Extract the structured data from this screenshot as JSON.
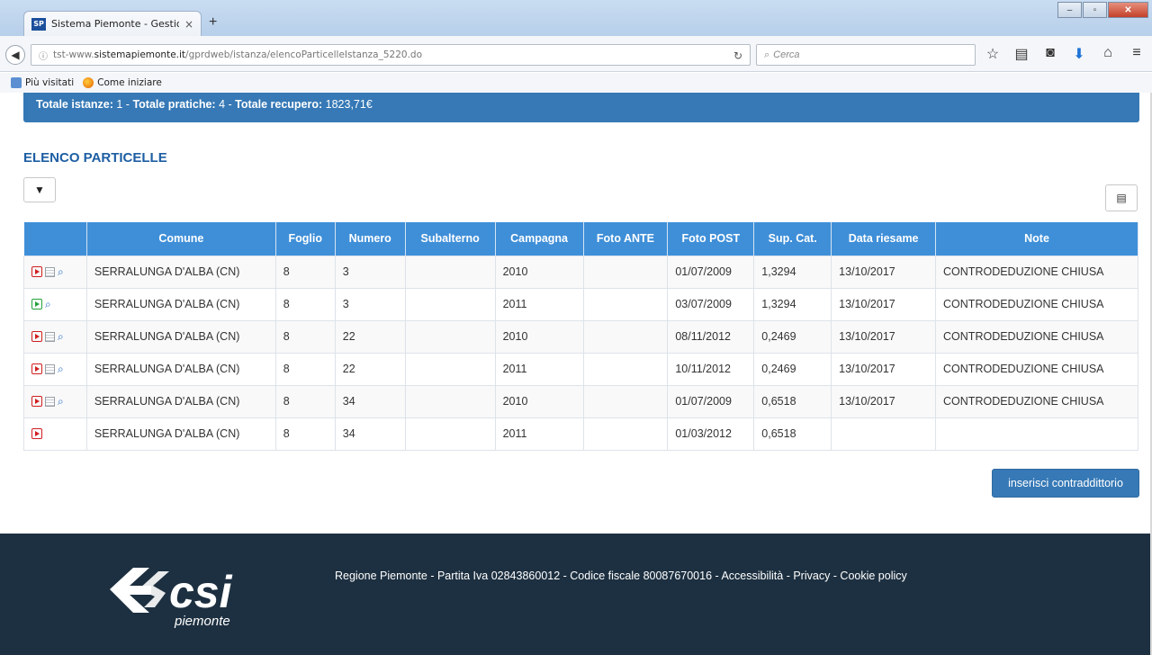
{
  "browser": {
    "tab_title": "Sistema Piemonte - Gestio...",
    "tab_favicon": "SP",
    "tab_close": "×",
    "new_tab": "+",
    "url_prefix": "tst-www.",
    "url_host": "sistemapiemonte.it",
    "url_path": "/gprdweb/istanza/elencoParticelleIstanza_5220.do",
    "search_placeholder": "Cerca",
    "bookmarks": [
      "Più visitati",
      "Come iniziare"
    ]
  },
  "banner": {
    "istanze_label": "Totale istanze:",
    "istanze_value": " 1 - ",
    "pratiche_label": "Totale pratiche:",
    "pratiche_value": " 4 - ",
    "recupero_label": "Totale recupero:",
    "recupero_value": " 1823,71€"
  },
  "section_title": "ELENCO PARTICELLE",
  "table": {
    "headers": [
      "",
      "Comune",
      "Foglio",
      "Numero",
      "Subalterno",
      "Campagna",
      "Foto ANTE",
      "Foto POST",
      "Sup. Cat.",
      "Data riesame",
      "Note"
    ],
    "rows": [
      {
        "icons": [
          "play-red",
          "doc",
          "mag"
        ],
        "cells": [
          "SERRALUNGA D'ALBA (CN)",
          "8",
          "3",
          "",
          "2010",
          "",
          "01/07/2009",
          "1,3294",
          "13/10/2017",
          "CONTRODEDUZIONE CHIUSA"
        ]
      },
      {
        "icons": [
          "play-green",
          "mag"
        ],
        "cells": [
          "SERRALUNGA D'ALBA (CN)",
          "8",
          "3",
          "",
          "2011",
          "",
          "03/07/2009",
          "1,3294",
          "13/10/2017",
          "CONTRODEDUZIONE CHIUSA"
        ]
      },
      {
        "icons": [
          "play-red",
          "doc",
          "mag"
        ],
        "cells": [
          "SERRALUNGA D'ALBA (CN)",
          "8",
          "22",
          "",
          "2010",
          "",
          "08/11/2012",
          "0,2469",
          "13/10/2017",
          "CONTRODEDUZIONE CHIUSA"
        ]
      },
      {
        "icons": [
          "play-red",
          "doc",
          "mag"
        ],
        "cells": [
          "SERRALUNGA D'ALBA (CN)",
          "8",
          "22",
          "",
          "2011",
          "",
          "10/11/2012",
          "0,2469",
          "13/10/2017",
          "CONTRODEDUZIONE CHIUSA"
        ]
      },
      {
        "icons": [
          "play-red",
          "doc",
          "mag"
        ],
        "cells": [
          "SERRALUNGA D'ALBA (CN)",
          "8",
          "34",
          "",
          "2010",
          "",
          "01/07/2009",
          "0,6518",
          "13/10/2017",
          "CONTRODEDUZIONE CHIUSA"
        ]
      },
      {
        "icons": [
          "play-red"
        ],
        "cells": [
          "SERRALUNGA D'ALBA (CN)",
          "8",
          "34",
          "",
          "2011",
          "",
          "01/03/2012",
          "0,6518",
          "",
          ""
        ]
      }
    ]
  },
  "insert_button": "inserisci contraddittorio",
  "footer": {
    "logo_text": "csi",
    "logo_subtext": "piemonte",
    "text": "Regione Piemonte - Partita Iva 02843860012 - Codice fiscale 80087670016 - Accessibilità - Privacy - Cookie policy"
  },
  "colors": {
    "banner": "#3679b6",
    "table_header": "#3f8fd8",
    "title": "#1d5ea3",
    "footer": "#1d3041"
  }
}
